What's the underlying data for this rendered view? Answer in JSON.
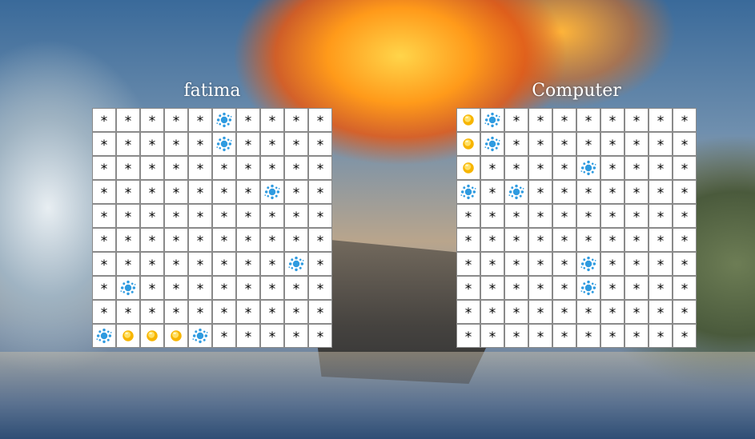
{
  "players": [
    {
      "name": "fatima",
      "grid": [
        "*****W****",
        "*****W****",
        "**********",
        "*******W**",
        "**********",
        "**********",
        "********W*",
        "*W********",
        "**********",
        "WHHHW*****"
      ]
    },
    {
      "name": "Computer",
      "grid": [
        "HW********",
        "HW********",
        "H****W****",
        "W*W*******",
        "**********",
        "**********",
        "*****W****",
        "*****W****",
        "**********",
        "**********"
      ]
    }
  ],
  "legend": {
    "unknown_symbol": "*",
    "miss_icon": "water-splash-icon",
    "hit_icon": "hit-marker-icon"
  },
  "colors": {
    "cell_bg": "#ffffff",
    "cell_border": "#8a8a8a",
    "splash": "#2f9be0",
    "hit_outer": "#f7b500",
    "hit_inner": "#ffe066",
    "title": "#ffffff"
  }
}
